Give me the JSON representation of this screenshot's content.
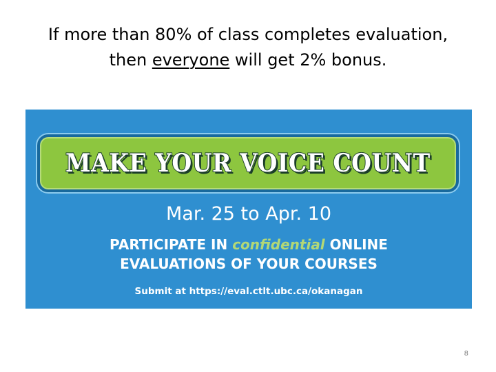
{
  "slide": {
    "title_line1": "If more than 80% of class completes evaluation,",
    "title_line2_before": "then ",
    "title_line2_underlined": "everyone",
    "title_line2_after": " will get 2% bonus.",
    "page_number": "8"
  },
  "banner": {
    "headline": "MAKE YOUR VOICE COUNT",
    "date_range": "Mar. 25 to Apr. 10",
    "participate_before": "PARTICIPATE IN ",
    "participate_emphasis": "confidential",
    "participate_after": " ONLINE",
    "participate_line2": "EVALUATIONS OF YOUR COURSES",
    "submit_text": "Submit at https://eval.ctlt.ubc.ca/okanagan",
    "colors": {
      "background": "#2f8fd0",
      "headline_box": "#8dc63f",
      "emphasis": "#b3d876"
    }
  }
}
